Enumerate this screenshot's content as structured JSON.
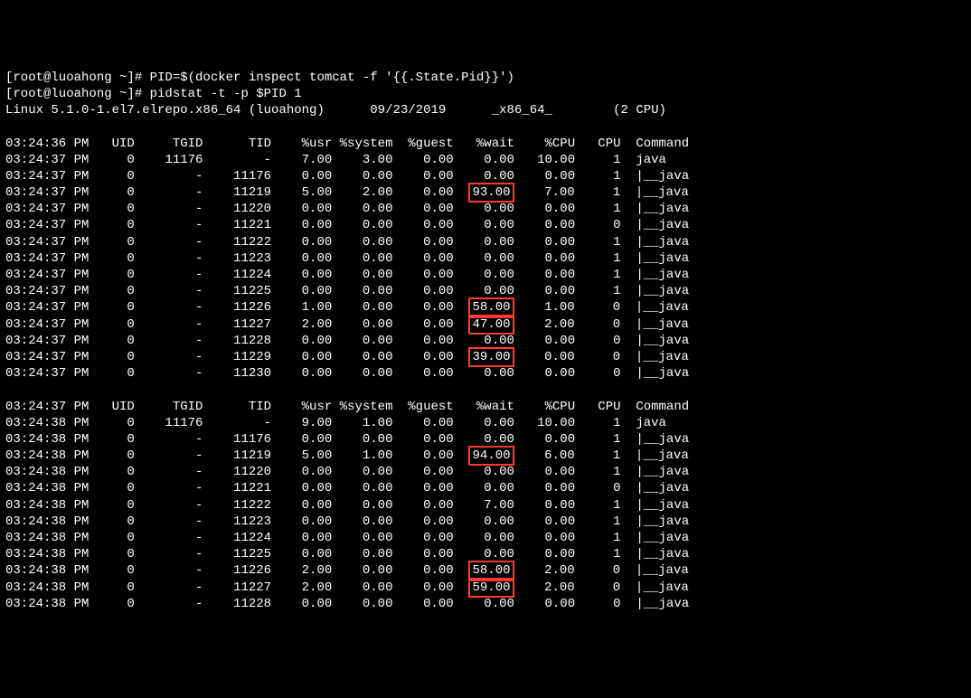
{
  "cmd1_prompt": "[root@luoahong ~]# ",
  "cmd1": "PID=$(docker inspect tomcat -f '{{.State.Pid}}')",
  "cmd2_prompt": "[root@luoahong ~]# ",
  "cmd2": "pidstat -t -p $PID 1",
  "sysline": "Linux 5.1.0-1.el7.elrepo.x86_64 (luoahong)      09/23/2019      _x86_64_        (2 CPU)",
  "hdr": {
    "time": "",
    "uid": "UID",
    "tgid": "TGID",
    "tid": "TID",
    "usr": "%usr",
    "system": "%system",
    "guest": "%guest",
    "wait": "%wait",
    "cpu": "%CPU",
    "cpu_n": "CPU",
    "command": "Command"
  },
  "block1": {
    "hdr_time": "03:24:36 PM",
    "rows": [
      {
        "time": "03:24:37 PM",
        "uid": "0",
        "tgid": "11176",
        "tid": "-",
        "usr": "7.00",
        "system": "3.00",
        "guest": "0.00",
        "wait": "0.00",
        "cpu": "10.00",
        "cpu_n": "1",
        "command": "java",
        "hl": false
      },
      {
        "time": "03:24:37 PM",
        "uid": "0",
        "tgid": "-",
        "tid": "11176",
        "usr": "0.00",
        "system": "0.00",
        "guest": "0.00",
        "wait": "0.00",
        "cpu": "0.00",
        "cpu_n": "1",
        "command": "|__java",
        "hl": false
      },
      {
        "time": "03:24:37 PM",
        "uid": "0",
        "tgid": "-",
        "tid": "11219",
        "usr": "5.00",
        "system": "2.00",
        "guest": "0.00",
        "wait": "93.00",
        "cpu": "7.00",
        "cpu_n": "1",
        "command": "|__java",
        "hl": true
      },
      {
        "time": "03:24:37 PM",
        "uid": "0",
        "tgid": "-",
        "tid": "11220",
        "usr": "0.00",
        "system": "0.00",
        "guest": "0.00",
        "wait": "0.00",
        "cpu": "0.00",
        "cpu_n": "1",
        "command": "|__java",
        "hl": false
      },
      {
        "time": "03:24:37 PM",
        "uid": "0",
        "tgid": "-",
        "tid": "11221",
        "usr": "0.00",
        "system": "0.00",
        "guest": "0.00",
        "wait": "0.00",
        "cpu": "0.00",
        "cpu_n": "0",
        "command": "|__java",
        "hl": false
      },
      {
        "time": "03:24:37 PM",
        "uid": "0",
        "tgid": "-",
        "tid": "11222",
        "usr": "0.00",
        "system": "0.00",
        "guest": "0.00",
        "wait": "0.00",
        "cpu": "0.00",
        "cpu_n": "1",
        "command": "|__java",
        "hl": false
      },
      {
        "time": "03:24:37 PM",
        "uid": "0",
        "tgid": "-",
        "tid": "11223",
        "usr": "0.00",
        "system": "0.00",
        "guest": "0.00",
        "wait": "0.00",
        "cpu": "0.00",
        "cpu_n": "1",
        "command": "|__java",
        "hl": false
      },
      {
        "time": "03:24:37 PM",
        "uid": "0",
        "tgid": "-",
        "tid": "11224",
        "usr": "0.00",
        "system": "0.00",
        "guest": "0.00",
        "wait": "0.00",
        "cpu": "0.00",
        "cpu_n": "1",
        "command": "|__java",
        "hl": false
      },
      {
        "time": "03:24:37 PM",
        "uid": "0",
        "tgid": "-",
        "tid": "11225",
        "usr": "0.00",
        "system": "0.00",
        "guest": "0.00",
        "wait": "0.00",
        "cpu": "0.00",
        "cpu_n": "1",
        "command": "|__java",
        "hl": false
      },
      {
        "time": "03:24:37 PM",
        "uid": "0",
        "tgid": "-",
        "tid": "11226",
        "usr": "1.00",
        "system": "0.00",
        "guest": "0.00",
        "wait": "58.00",
        "cpu": "1.00",
        "cpu_n": "0",
        "command": "|__java",
        "hl": true
      },
      {
        "time": "03:24:37 PM",
        "uid": "0",
        "tgid": "-",
        "tid": "11227",
        "usr": "2.00",
        "system": "0.00",
        "guest": "0.00",
        "wait": "47.00",
        "cpu": "2.00",
        "cpu_n": "0",
        "command": "|__java",
        "hl": true
      },
      {
        "time": "03:24:37 PM",
        "uid": "0",
        "tgid": "-",
        "tid": "11228",
        "usr": "0.00",
        "system": "0.00",
        "guest": "0.00",
        "wait": "0.00",
        "cpu": "0.00",
        "cpu_n": "0",
        "command": "|__java",
        "hl": false
      },
      {
        "time": "03:24:37 PM",
        "uid": "0",
        "tgid": "-",
        "tid": "11229",
        "usr": "0.00",
        "system": "0.00",
        "guest": "0.00",
        "wait": "39.00",
        "cpu": "0.00",
        "cpu_n": "0",
        "command": "|__java",
        "hl": true
      },
      {
        "time": "03:24:37 PM",
        "uid": "0",
        "tgid": "-",
        "tid": "11230",
        "usr": "0.00",
        "system": "0.00",
        "guest": "0.00",
        "wait": "0.00",
        "cpu": "0.00",
        "cpu_n": "0",
        "command": "|__java",
        "hl": false
      }
    ]
  },
  "block2": {
    "hdr_time": "03:24:37 PM",
    "rows": [
      {
        "time": "03:24:38 PM",
        "uid": "0",
        "tgid": "11176",
        "tid": "-",
        "usr": "9.00",
        "system": "1.00",
        "guest": "0.00",
        "wait": "0.00",
        "cpu": "10.00",
        "cpu_n": "1",
        "command": "java",
        "hl": false
      },
      {
        "time": "03:24:38 PM",
        "uid": "0",
        "tgid": "-",
        "tid": "11176",
        "usr": "0.00",
        "system": "0.00",
        "guest": "0.00",
        "wait": "0.00",
        "cpu": "0.00",
        "cpu_n": "1",
        "command": "|__java",
        "hl": false
      },
      {
        "time": "03:24:38 PM",
        "uid": "0",
        "tgid": "-",
        "tid": "11219",
        "usr": "5.00",
        "system": "1.00",
        "guest": "0.00",
        "wait": "94.00",
        "cpu": "6.00",
        "cpu_n": "1",
        "command": "|__java",
        "hl": true
      },
      {
        "time": "03:24:38 PM",
        "uid": "0",
        "tgid": "-",
        "tid": "11220",
        "usr": "0.00",
        "system": "0.00",
        "guest": "0.00",
        "wait": "0.00",
        "cpu": "0.00",
        "cpu_n": "1",
        "command": "|__java",
        "hl": false
      },
      {
        "time": "03:24:38 PM",
        "uid": "0",
        "tgid": "-",
        "tid": "11221",
        "usr": "0.00",
        "system": "0.00",
        "guest": "0.00",
        "wait": "0.00",
        "cpu": "0.00",
        "cpu_n": "0",
        "command": "|__java",
        "hl": false
      },
      {
        "time": "03:24:38 PM",
        "uid": "0",
        "tgid": "-",
        "tid": "11222",
        "usr": "0.00",
        "system": "0.00",
        "guest": "0.00",
        "wait": "7.00",
        "cpu": "0.00",
        "cpu_n": "1",
        "command": "|__java",
        "hl": false
      },
      {
        "time": "03:24:38 PM",
        "uid": "0",
        "tgid": "-",
        "tid": "11223",
        "usr": "0.00",
        "system": "0.00",
        "guest": "0.00",
        "wait": "0.00",
        "cpu": "0.00",
        "cpu_n": "1",
        "command": "|__java",
        "hl": false
      },
      {
        "time": "03:24:38 PM",
        "uid": "0",
        "tgid": "-",
        "tid": "11224",
        "usr": "0.00",
        "system": "0.00",
        "guest": "0.00",
        "wait": "0.00",
        "cpu": "0.00",
        "cpu_n": "1",
        "command": "|__java",
        "hl": false
      },
      {
        "time": "03:24:38 PM",
        "uid": "0",
        "tgid": "-",
        "tid": "11225",
        "usr": "0.00",
        "system": "0.00",
        "guest": "0.00",
        "wait": "0.00",
        "cpu": "0.00",
        "cpu_n": "1",
        "command": "|__java",
        "hl": false
      },
      {
        "time": "03:24:38 PM",
        "uid": "0",
        "tgid": "-",
        "tid": "11226",
        "usr": "2.00",
        "system": "0.00",
        "guest": "0.00",
        "wait": "58.00",
        "cpu": "2.00",
        "cpu_n": "0",
        "command": "|__java",
        "hl": true
      },
      {
        "time": "03:24:38 PM",
        "uid": "0",
        "tgid": "-",
        "tid": "11227",
        "usr": "2.00",
        "system": "0.00",
        "guest": "0.00",
        "wait": "59.00",
        "cpu": "2.00",
        "cpu_n": "0",
        "command": "|__java",
        "hl": true
      },
      {
        "time": "03:24:38 PM",
        "uid": "0",
        "tgid": "-",
        "tid": "11228",
        "usr": "0.00",
        "system": "0.00",
        "guest": "0.00",
        "wait": "0.00",
        "cpu": "0.00",
        "cpu_n": "0",
        "command": "|__java",
        "hl": false
      }
    ]
  }
}
